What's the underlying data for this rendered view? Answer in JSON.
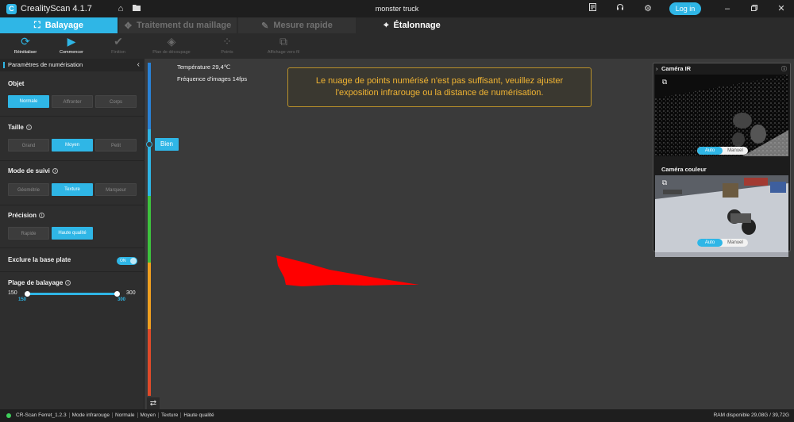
{
  "app": {
    "title": "CrealityScan 4.1.7",
    "project": "monster truck",
    "login": "Log in"
  },
  "tabs": [
    {
      "label": "Balayage"
    },
    {
      "label": "Traitement du maillage"
    },
    {
      "label": "Mesure rapide"
    },
    {
      "label": "Étalonnage"
    }
  ],
  "toolbar": {
    "reset": "Réinitialiser",
    "start": "Commencer",
    "finish": "Finition",
    "crop": "Plan de découpage",
    "pointcloud": "Points",
    "fit": "Affichage vers fil"
  },
  "panel": {
    "title": "Paramètres de numérisation",
    "object": {
      "label": "Objet",
      "options": [
        "Normale",
        "Affronter",
        "Corps"
      ],
      "selected": "Normale"
    },
    "size": {
      "label": "Taille",
      "options": [
        "Grand",
        "Moyen",
        "Petit"
      ],
      "selected": "Moyen"
    },
    "tracking": {
      "label": "Mode de suivi",
      "options": [
        "Géométrie",
        "Texture",
        "Marqueur"
      ],
      "selected": "Texture"
    },
    "precision": {
      "label": "Précision",
      "options": [
        "Rapide",
        "Haute qualité"
      ],
      "selected": "Haute qualité"
    },
    "exclude_base": {
      "label": "Exclure la base plate",
      "state": "ON"
    },
    "range": {
      "label": "Plage de balayage",
      "min": "150",
      "max": "300",
      "low": "150",
      "high": "300"
    }
  },
  "viewport": {
    "temperature": "Température 29,4℃",
    "framerate": "Fréquence d'images 14fps",
    "gauge_label": "Bien",
    "warning": "Le nuage de points numérisé n'est pas suffisant, veuillez ajuster l'exposition infrarouge ou la distance de numérisation.",
    "gauge_colors": [
      "#2a82d6",
      "#2fb6e6",
      "#3ec23e",
      "#f0a020",
      "#e04a2a"
    ]
  },
  "cameras": {
    "ir_title": "Caméra IR",
    "color_title": "Caméra couleur",
    "auto": "Auto",
    "manual": "Manuel"
  },
  "status": {
    "device": "CR-Scan Ferret_1.2.3",
    "mode": "Mode infrarouge",
    "object": "Normale",
    "size": "Moyen",
    "tracking": "Texture",
    "quality": "Haute qualité",
    "ram": "RAM disponible 29,08G / 39,72G"
  },
  "colors": {
    "accent": "#2fb6e6",
    "warning": "#f2b533",
    "cloud": "#ff0000"
  }
}
